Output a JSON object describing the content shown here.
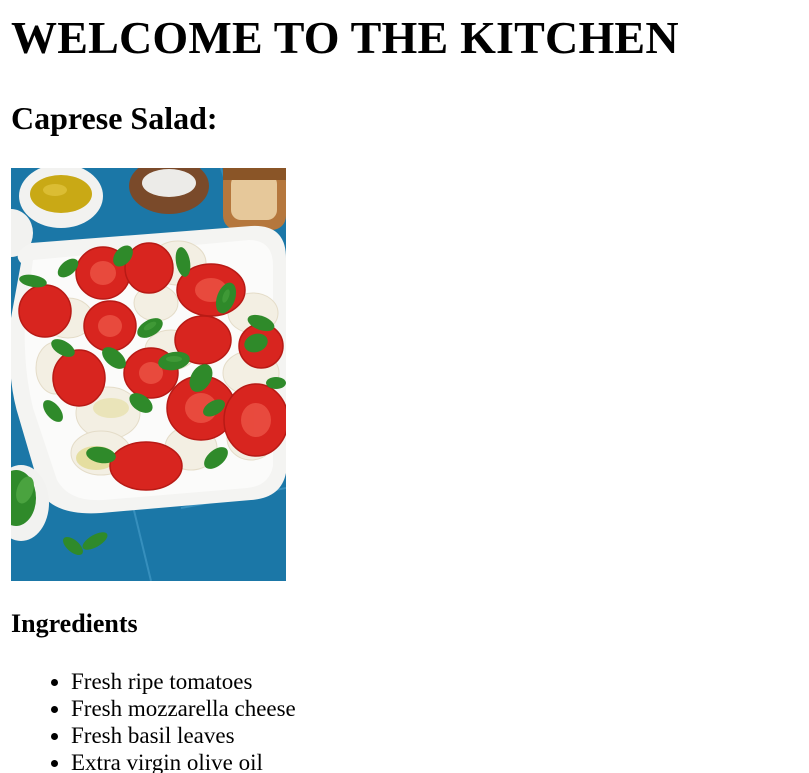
{
  "page": {
    "heading": "WELCOME TO THE KITCHEN",
    "recipe_title": "Caprese Salad:",
    "photo": {
      "subject": "caprese-salad-photo",
      "colors": {
        "background": "#1f7fb0",
        "plate": "#f4f4f2",
        "tomato": "#d8251f",
        "mozzarella": "#f3efe3",
        "basil": "#2f8a2a",
        "olive_oil": "#c9a915",
        "bread": "#b5773d"
      }
    },
    "ingredients_heading": "Ingredients",
    "ingredients": [
      "Fresh ripe tomatoes",
      "Fresh mozzarella cheese",
      "Fresh basil leaves",
      "Extra virgin olive oil"
    ]
  }
}
